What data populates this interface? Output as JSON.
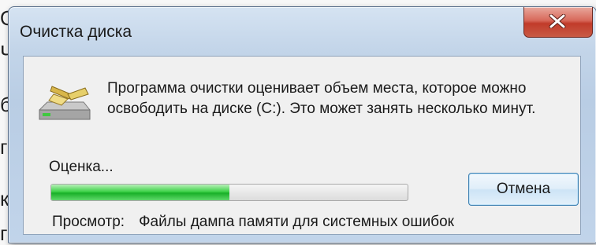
{
  "window": {
    "title": "Очистка диска",
    "close_icon": "close-icon"
  },
  "dialog": {
    "icon": "disk-cleanup-icon",
    "message": "Программа очистки оценивает объем места, которое можно освободить на диске  (C:). Это может занять несколько минут.",
    "status_label": "Оценка...",
    "progress_fraction": 0.5,
    "cancel_label": "Отмена",
    "details_label": "Просмотр:",
    "details_value": "Файлы дампа памяти для системных ошибок"
  }
}
